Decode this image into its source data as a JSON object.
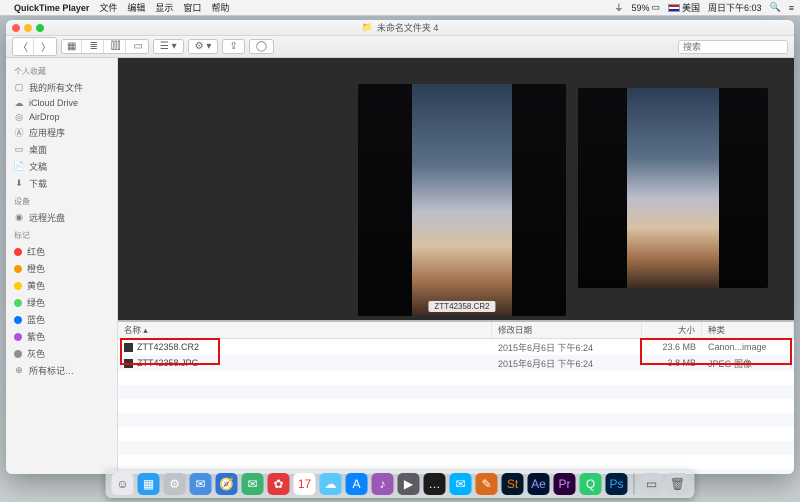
{
  "menubar": {
    "app": "QuickTime Player",
    "items": [
      "文件",
      "编辑",
      "显示",
      "窗口",
      "帮助"
    ],
    "battery": "59%",
    "country": "美国",
    "clock": "周日下午6:03"
  },
  "window": {
    "title": "未命名文件夹 4"
  },
  "toolbar": {
    "search_placeholder": "搜索"
  },
  "sidebar": {
    "sections": [
      {
        "header": "个人收藏",
        "items": [
          {
            "icon": "box",
            "label": "我的所有文件"
          },
          {
            "icon": "cloud",
            "label": "iCloud Drive"
          },
          {
            "icon": "airdrop",
            "label": "AirDrop"
          },
          {
            "icon": "apps",
            "label": "应用程序"
          },
          {
            "icon": "desktop",
            "label": "桌面"
          },
          {
            "icon": "docs",
            "label": "文稿"
          },
          {
            "icon": "download",
            "label": "下载"
          }
        ]
      },
      {
        "header": "设备",
        "items": [
          {
            "icon": "disc",
            "label": "远程光盘"
          }
        ]
      },
      {
        "header": "标记",
        "items": [
          {
            "color": "#ff3b30",
            "label": "红色"
          },
          {
            "color": "#ff9500",
            "label": "橙色"
          },
          {
            "color": "#ffcc00",
            "label": "黄色"
          },
          {
            "color": "#4cd964",
            "label": "绿色"
          },
          {
            "color": "#007aff",
            "label": "蓝色"
          },
          {
            "color": "#af52de",
            "label": "紫色"
          },
          {
            "color": "#8e8e93",
            "label": "灰色"
          },
          {
            "icon": "alltags",
            "label": "所有标记…"
          }
        ]
      }
    ]
  },
  "preview": {
    "caption": "ZTT42358.CR2"
  },
  "list": {
    "headers": {
      "name": "名称",
      "date": "修改日期",
      "size": "大小",
      "kind": "种类"
    },
    "rows": [
      {
        "name": "ZTT42358.CR2",
        "date": "2015年6月6日 下午6:24",
        "size": "23.6 MB",
        "kind": "Canon...image"
      },
      {
        "name": "ZTT42358.JPG",
        "date": "2015年6月6日 下午6:24",
        "size": "3.8 MB",
        "kind": "JPEG 图像"
      }
    ]
  },
  "dock": {
    "items": [
      {
        "bg": "#e9e9ee",
        "fg": "#555",
        "glyph": "☺"
      },
      {
        "bg": "#2a9df4",
        "glyph": "▦"
      },
      {
        "bg": "#bfc3c7",
        "glyph": "⚙"
      },
      {
        "bg": "#4a90e2",
        "glyph": "✉"
      },
      {
        "bg": "#3073d6",
        "glyph": "🧭"
      },
      {
        "bg": "#3cb371",
        "glyph": "✉"
      },
      {
        "bg": "#e23b3b",
        "glyph": "✿"
      },
      {
        "bg": "#ffffff",
        "fg": "#e33",
        "glyph": "17"
      },
      {
        "bg": "#5ac8fa",
        "glyph": "☁"
      },
      {
        "bg": "#0b84ff",
        "glyph": "A"
      },
      {
        "bg": "#9b59b6",
        "glyph": "♪"
      },
      {
        "bg": "#5c5c62",
        "glyph": "▶"
      },
      {
        "bg": "#1c1c1c",
        "glyph": "…"
      },
      {
        "bg": "#00b3ff",
        "glyph": "✉"
      },
      {
        "bg": "#d86b1f",
        "glyph": "✎"
      },
      {
        "bg": "#00172e",
        "fg": "#ff7b00",
        "glyph": "St"
      },
      {
        "bg": "#00122e",
        "fg": "#9a9aff",
        "glyph": "Ae"
      },
      {
        "bg": "#2a003a",
        "fg": "#d38cff",
        "glyph": "Pr"
      },
      {
        "bg": "#2ecc71",
        "glyph": "Q"
      },
      {
        "bg": "#001e3c",
        "fg": "#31a8ff",
        "glyph": "Ps"
      }
    ],
    "right": [
      {
        "bg": "#cfd3d8",
        "fg": "#555",
        "glyph": "▭"
      },
      {
        "bg": "#cfd3d8",
        "fg": "#555",
        "glyph": "🗑"
      }
    ]
  }
}
